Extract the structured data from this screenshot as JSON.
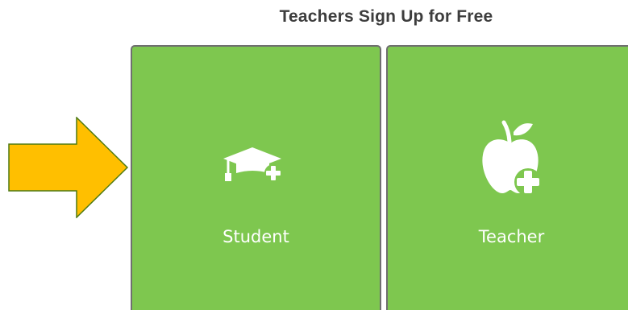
{
  "header": {
    "title": "Teachers Sign Up for Free"
  },
  "tiles": [
    {
      "label": "Student",
      "icon": "graduation-cap-plus-icon"
    },
    {
      "label": "Teacher",
      "icon": "apple-plus-icon"
    }
  ],
  "colors": {
    "tile_background": "#7ec74f",
    "tile_border": "#6f6f6f",
    "arrow_fill": "#ffbf00",
    "arrow_stroke": "#4f7a12",
    "title_text": "#3d3d3d",
    "tile_text": "#ffffff"
  },
  "indicator": {
    "icon": "right-arrow-icon",
    "points_to": "Student"
  }
}
